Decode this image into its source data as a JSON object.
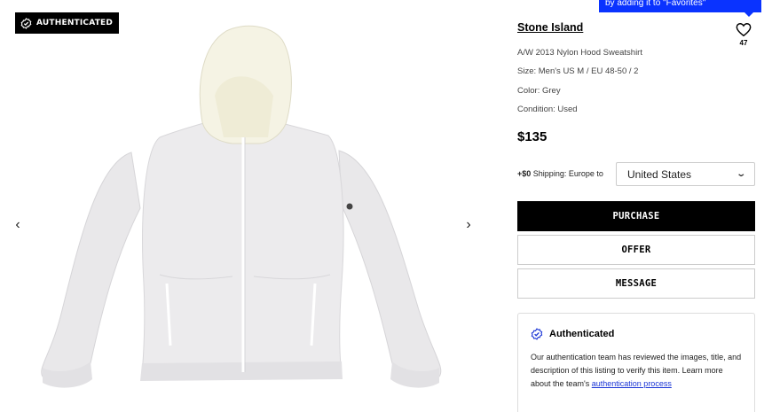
{
  "gallery": {
    "badge_label": "AUTHENTICATED",
    "badge_icon": "verified-badge-icon",
    "prev_icon": "chevron-left-icon",
    "next_icon": "chevron-right-icon",
    "image_subject": "grey zip hooded sweatshirt with cream nylon hood"
  },
  "tooltip": {
    "text": "by adding it to \"Favorites\"",
    "color": "#0a33ff"
  },
  "listing": {
    "brand": "Stone Island",
    "title": "A/W 2013 Nylon Hood Sweatshirt",
    "size": "Size: Men's US M / EU 48-50 / 2",
    "color": "Color: Grey",
    "condition": "Condition: Used",
    "price": "$135",
    "favorite_icon": "heart-icon",
    "favorite_count": "47"
  },
  "shipping": {
    "amount": "+$0",
    "label": "Shipping: Europe to",
    "country": "United States",
    "dropdown_icon": "chevron-down-icon"
  },
  "actions": {
    "purchase": "PURCHASE",
    "offer": "OFFER",
    "message": "MESSAGE"
  },
  "authentication": {
    "title": "Authenticated",
    "icon": "verified-badge-icon",
    "body": "Our authentication team has reviewed the images, title, and description of this listing to verify this item. Learn more about the team's ",
    "link": "authentication process",
    "link_color": "#1a35d6"
  }
}
